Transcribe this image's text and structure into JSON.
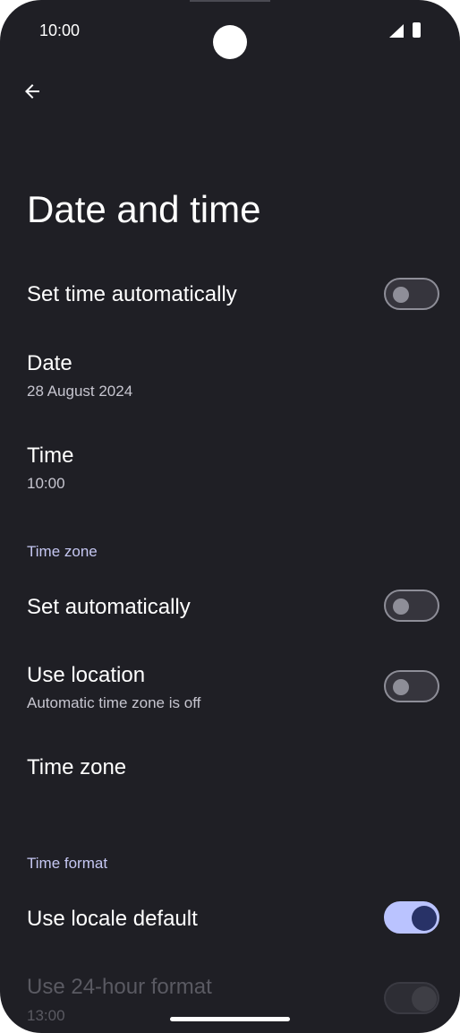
{
  "status_bar": {
    "time": "10:00"
  },
  "header": {
    "title": "Date and time"
  },
  "settings": {
    "set_time_automatically": {
      "label": "Set time automatically",
      "enabled": false
    },
    "date": {
      "label": "Date",
      "value": "28 August 2024"
    },
    "time": {
      "label": "Time",
      "value": "10:00"
    },
    "time_zone_section": {
      "header": "Time zone"
    },
    "tz_set_automatically": {
      "label": "Set automatically",
      "enabled": false
    },
    "use_location": {
      "label": "Use location",
      "summary": "Automatic time zone is off",
      "enabled": false
    },
    "time_zone": {
      "label": "Time zone"
    },
    "time_format_section": {
      "header": "Time format"
    },
    "use_locale_default": {
      "label": "Use locale default",
      "enabled": true
    },
    "use_24_hour": {
      "label": "Use 24-hour format",
      "summary": "13:00",
      "enabled": true,
      "disabled": true
    }
  },
  "colors": {
    "background": "#1f1f25",
    "accent": "#bac3ff",
    "section_header": "#c5c7f2"
  },
  "icons": {
    "back": "arrow-back-icon",
    "signal": "signal-icon",
    "battery": "battery-icon"
  }
}
